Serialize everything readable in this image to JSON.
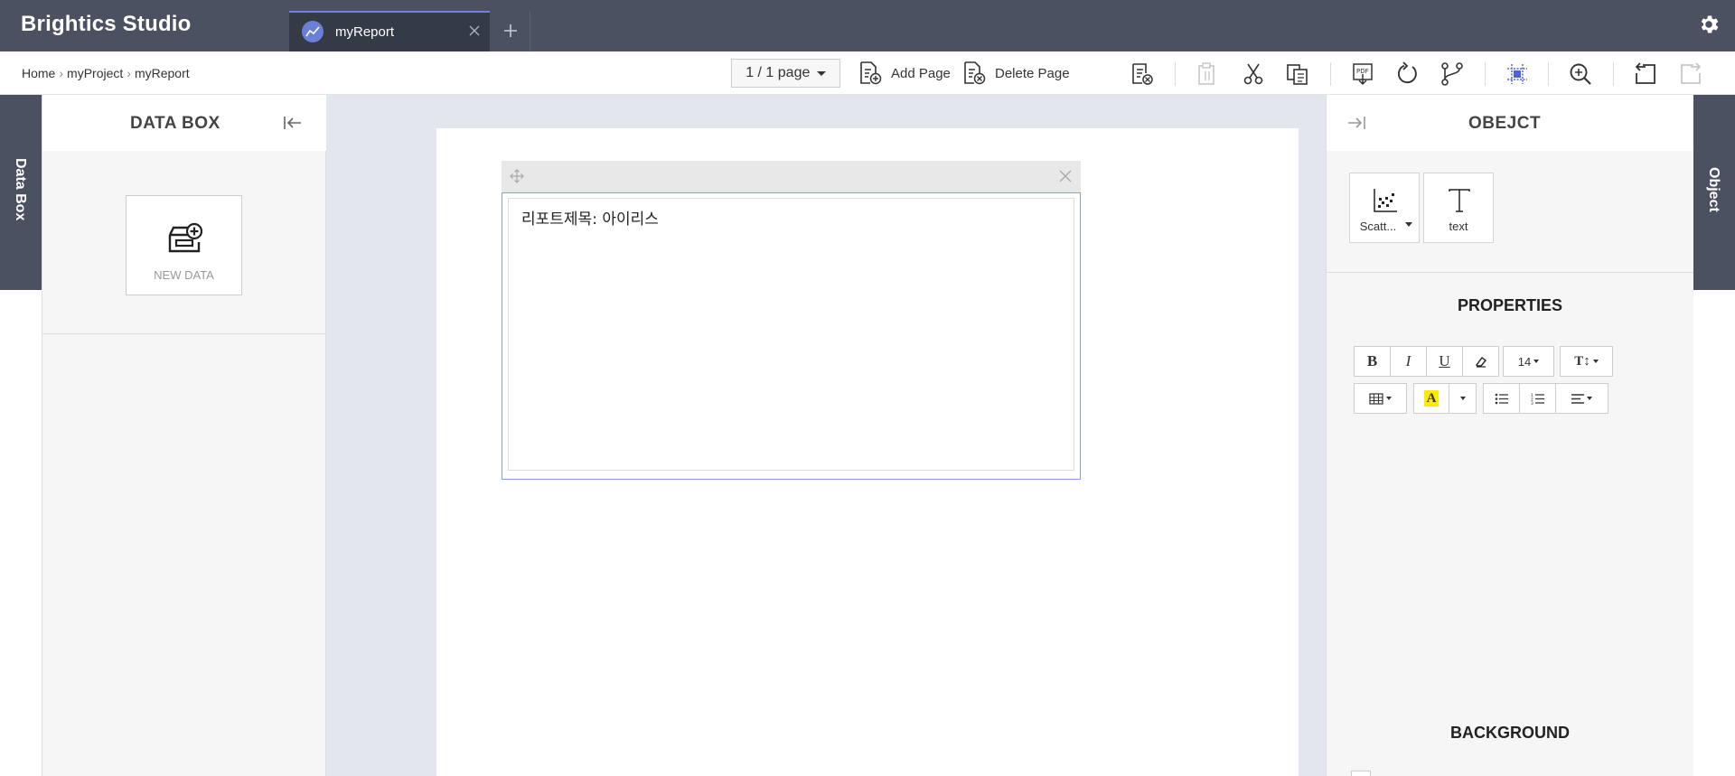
{
  "app": {
    "brand": "Brightics Studio"
  },
  "tabs": [
    {
      "label": "myReport",
      "active": true
    }
  ],
  "breadcrumb": {
    "items": [
      "Home",
      "myProject",
      "myReport"
    ]
  },
  "toolbar": {
    "page_select": "1 / 1 page",
    "add_page": "Add Page",
    "delete_page": "Delete Page"
  },
  "left_rail": {
    "label": "Data Box"
  },
  "databox": {
    "title": "DATA BOX",
    "new_data_label": "NEW DATA"
  },
  "canvas": {
    "text_object": {
      "content": "리포트제목: 아이리스"
    }
  },
  "object_panel": {
    "title": "OBEJCT",
    "objects": [
      {
        "label": "Scatt...",
        "icon": "scatter-chart-icon",
        "has_dropdown": true
      },
      {
        "label": "text",
        "icon": "text-icon",
        "has_dropdown": false
      }
    ],
    "properties_title": "PROPERTIES",
    "font_size": "14",
    "background_title": "BACKGROUND"
  },
  "right_rail": {
    "label": "Object"
  },
  "colors": {
    "header_bg": "#4b5160",
    "accent": "#6f80e5",
    "canvas_bg": "#e4e6ef",
    "highlight_yellow": "#ffeb00"
  }
}
